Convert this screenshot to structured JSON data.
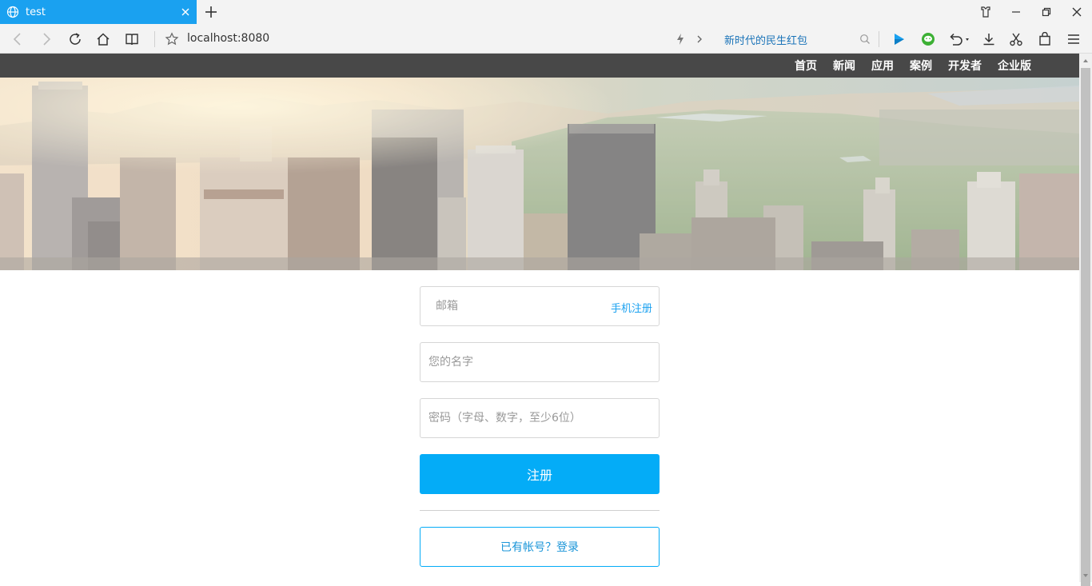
{
  "browser": {
    "tab_title": "test",
    "address": "localhost:8080",
    "news_text": "新时代的民生红包"
  },
  "nav": {
    "items": [
      "首页",
      "新闻",
      "应用",
      "案例",
      "开发者",
      "企业版"
    ]
  },
  "form": {
    "email_placeholder": "邮箱",
    "mobile_register": "手机注册",
    "name_placeholder": "您的名字",
    "password_placeholder": "密码（字母、数字，至少6位）",
    "submit_label": "注册",
    "login_label": "已有帐号？登录"
  },
  "colors": {
    "tab_active": "#1aa1f0",
    "primary": "#04acf7",
    "nav_bg": "#484848"
  }
}
